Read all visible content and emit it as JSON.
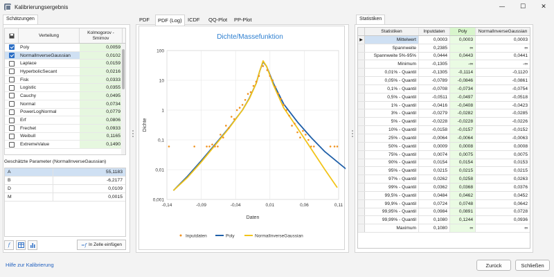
{
  "window": {
    "title": "Kalibrierungsergebnis"
  },
  "left": {
    "tab": "Schätzungen",
    "columns": {
      "name": "Verteilung",
      "metric": "Kolmogorov - Smirnov"
    },
    "rows": [
      {
        "name": "Poly",
        "value": "0,0059",
        "checked": true
      },
      {
        "name": "NormalInverseGaussian",
        "value": "0,0102",
        "checked": true
      },
      {
        "name": "Laplace",
        "value": "0,0159",
        "checked": false
      },
      {
        "name": "HyperbolicSecant",
        "value": "0,0216",
        "checked": false
      },
      {
        "name": "Fisk",
        "value": "0,0333",
        "checked": false
      },
      {
        "name": "Logistic",
        "value": "0,0355",
        "checked": false
      },
      {
        "name": "Cauchy",
        "value": "0,0495",
        "checked": false
      },
      {
        "name": "Normal",
        "value": "0,0734",
        "checked": false
      },
      {
        "name": "PowerLogNormal",
        "value": "0,0779",
        "checked": false
      },
      {
        "name": "Erf",
        "value": "0,0806",
        "checked": false
      },
      {
        "name": "Frechet",
        "value": "0,0933",
        "checked": false
      },
      {
        "name": "Weibull",
        "value": "0,1165",
        "checked": false
      },
      {
        "name": "ExtremeValue",
        "value": "0,1490",
        "checked": false
      }
    ],
    "params_title": "Geschätzte Parameter (NormalInverseGaussian)",
    "params": [
      {
        "key": "A",
        "value": "55,1183"
      },
      {
        "key": "B",
        "value": "-6,2177"
      },
      {
        "key": "D",
        "value": "0,0109"
      },
      {
        "key": "M",
        "value": "0,0015"
      }
    ],
    "insert_button": "In Zelle einfügen"
  },
  "middle": {
    "tabs": [
      "PDF",
      "PDF (Log)",
      "ICDF",
      "QQ-Plot",
      "PP-Plot"
    ],
    "active_tab": 1
  },
  "chart_data": {
    "type": "line",
    "title": "Dichte/Massefunktion",
    "xlabel": "Daten",
    "ylabel": "Dichte",
    "xlim": [
      -0.14,
      0.11
    ],
    "ylim_log10": [
      -3,
      2
    ],
    "x_ticks": [
      "-0,14",
      "-0,09",
      "-0,04",
      "0,01",
      "0,06",
      "0,11"
    ],
    "x_tick_values": [
      -0.14,
      -0.09,
      -0.04,
      0.01,
      0.06,
      0.11
    ],
    "y_ticks": [
      "100",
      "10",
      "1",
      "0,1",
      "0,01",
      "0,001"
    ],
    "y_tick_values": [
      100,
      10,
      1,
      0.1,
      0.01,
      0.001
    ],
    "legend": [
      "Inputdaten",
      "Poly",
      "NormalInverseGaussian"
    ],
    "legend_position": "bottom",
    "series": [
      {
        "name": "Poly",
        "color": "#1f5fa8",
        "x": [
          -0.1305,
          -0.11,
          -0.09,
          -0.07,
          -0.05,
          -0.03,
          -0.02,
          -0.01,
          -0.005,
          0.0,
          0.005,
          0.015,
          0.03,
          0.05,
          0.07,
          0.09,
          0.1244
        ],
        "y": [
          0.002,
          0.006,
          0.02,
          0.07,
          0.25,
          1.0,
          2.5,
          8.0,
          20,
          42,
          30,
          8.0,
          1.6,
          0.4,
          0.12,
          0.04,
          0.009
        ]
      },
      {
        "name": "NormalInverseGaussian",
        "color": "#f2c41a",
        "x": [
          -0.1305,
          -0.11,
          -0.09,
          -0.07,
          -0.05,
          -0.03,
          -0.02,
          -0.01,
          -0.005,
          0.0,
          0.005,
          0.015,
          0.03,
          0.05,
          0.07,
          0.09,
          0.108
        ],
        "y": [
          0.002,
          0.0055,
          0.018,
          0.065,
          0.24,
          1.0,
          2.4,
          8.0,
          20,
          45,
          30,
          7.0,
          1.2,
          0.25,
          0.05,
          0.01,
          0.0025
        ]
      },
      {
        "name": "Inputdaten",
        "color": "#f0921e",
        "type": "scatter",
        "x": [
          -0.137,
          -0.1,
          -0.082,
          -0.078,
          -0.074,
          -0.07,
          -0.066,
          -0.062,
          -0.058,
          -0.054,
          -0.05,
          -0.046,
          -0.042,
          -0.038,
          -0.034,
          -0.03,
          -0.026,
          -0.022,
          -0.018,
          -0.014,
          -0.01,
          -0.006,
          0.0,
          0.006,
          0.01,
          0.014,
          0.018,
          0.022,
          0.026,
          0.03,
          0.034,
          0.038,
          0.042,
          0.046,
          0.05,
          0.054,
          0.058,
          0.062,
          0.066,
          0.07,
          0.074,
          0.098,
          0.104,
          0.108
        ],
        "y": [
          0.06,
          0.06,
          0.06,
          0.06,
          0.07,
          0.06,
          0.06,
          0.15,
          0.12,
          0.3,
          0.25,
          0.6,
          0.5,
          1.0,
          1.2,
          1.5,
          2.2,
          3.5,
          4.0,
          6.5,
          9.0,
          14.0,
          30,
          22,
          14,
          10,
          6.0,
          3.6,
          2.4,
          1.5,
          1.0,
          0.65,
          0.3,
          0.35,
          0.18,
          0.12,
          0.2,
          0.15,
          0.1,
          0.06,
          0.06,
          0.06,
          0.06,
          0.06
        ]
      }
    ]
  },
  "right": {
    "tab": "Statistiken",
    "columns": [
      "Statistiken",
      "Inputdaten",
      "Poly",
      "NormalInverseGaussian"
    ],
    "rows": [
      [
        "Mittelwert",
        "0,0003",
        "0,0003",
        "0,0003"
      ],
      [
        "Spannweite",
        "0,2385",
        "∞",
        "∞"
      ],
      [
        "Spannweite 5%-95%",
        "0,0444",
        "0,0443",
        "0,0441"
      ],
      [
        "Minimum",
        "-0,1305",
        "-∞",
        "-∞"
      ],
      [
        "0,01% - Quantil",
        "-0,1305",
        "-0,1114",
        "-0,1120"
      ],
      [
        "0,05% - Quantil",
        "-0,0789",
        "-0,0846",
        "-0,0861"
      ],
      [
        "0,1% - Quantil",
        "-0,0708",
        "-0,0734",
        "-0,0754"
      ],
      [
        "0,5% - Quantil",
        "-0,0511",
        "-0,0497",
        "-0,0518"
      ],
      [
        "1% - Quantil",
        "-0,0416",
        "-0,0408",
        "-0,0423"
      ],
      [
        "3% - Quantil",
        "-0,0279",
        "-0,0282",
        "-0,0285"
      ],
      [
        "5% - Quantil",
        "-0,0228",
        "-0,0228",
        "-0,0226"
      ],
      [
        "10% - Quantil",
        "-0,0158",
        "-0,0157",
        "-0,0152"
      ],
      [
        "25% - Quantil",
        "-0,0064",
        "-0,0064",
        "-0,0063"
      ],
      [
        "50% - Quantil",
        "0,0009",
        "0,0008",
        "0,0008"
      ],
      [
        "75% - Quantil",
        "0,0074",
        "0,0075",
        "0,0075"
      ],
      [
        "90% - Quantil",
        "0,0154",
        "0,0154",
        "0,0153"
      ],
      [
        "95% - Quantil",
        "0,0215",
        "0,0215",
        "0,0215"
      ],
      [
        "97% - Quantil",
        "0,0262",
        "0,0258",
        "0,0263"
      ],
      [
        "99% - Quantil",
        "0,0362",
        "0,0368",
        "0,0376"
      ],
      [
        "99,5% - Quantil",
        "0,0484",
        "0,0462",
        "0,0452"
      ],
      [
        "99,9% - Quantil",
        "0,0724",
        "0,0748",
        "0,0642"
      ],
      [
        "99,95% - Quantil",
        "0,0984",
        "0,0891",
        "0,0728"
      ],
      [
        "99,99% - Quantil",
        "0,1080",
        "0,1244",
        "0,0936"
      ],
      [
        "Maximum",
        "0,1080",
        "∞",
        "∞"
      ]
    ]
  },
  "footer": {
    "help": "Hilfe zur Kalibrierung",
    "back": "Zurück",
    "close": "Schließen"
  },
  "colors": {
    "accent": "#2d6fc5",
    "poly": "#1f5fa8",
    "nig": "#f2c41a",
    "input": "#f0921e",
    "metric_bg": "#e6f7df"
  }
}
